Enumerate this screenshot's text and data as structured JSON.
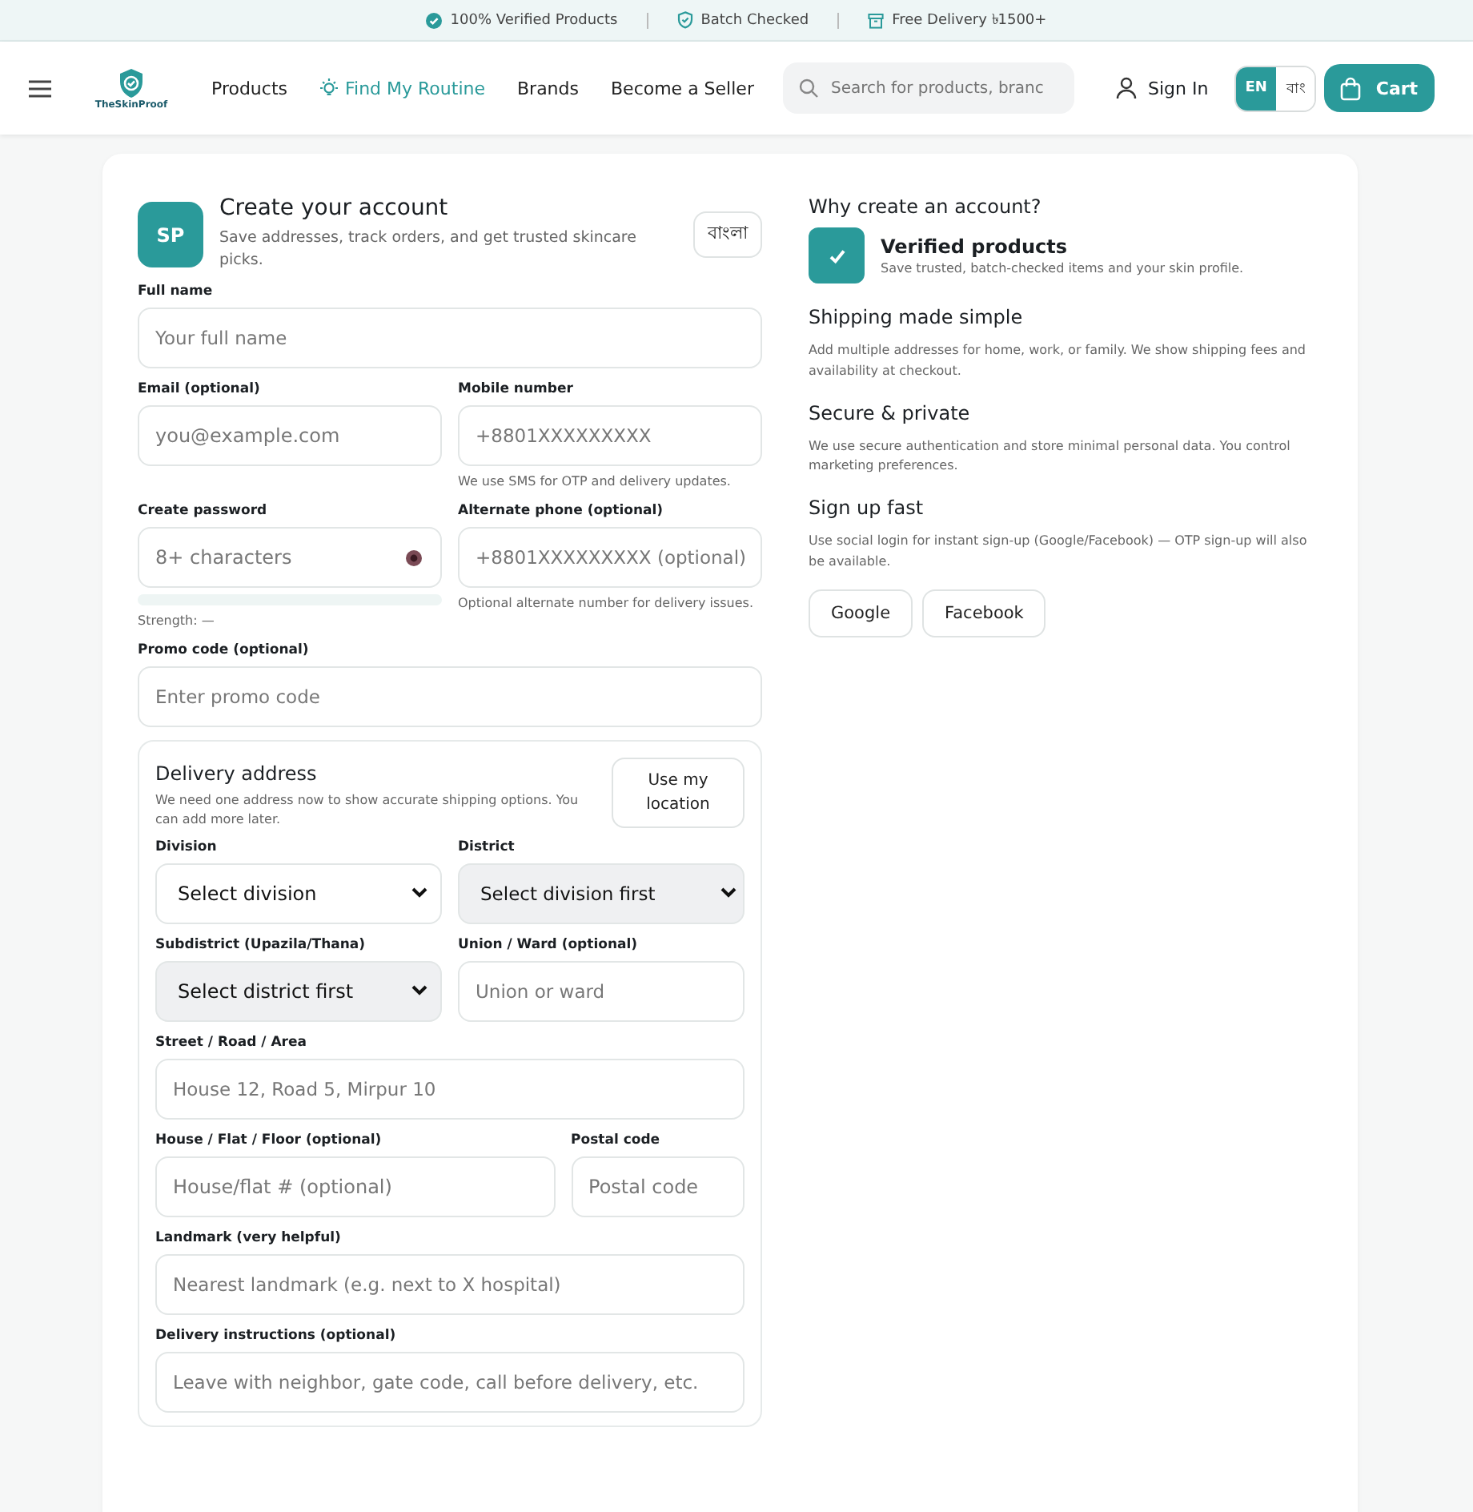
{
  "promo_bar": [
    {
      "text": "100% Verified Products"
    },
    {
      "text": "Batch Checked"
    },
    {
      "text": "Free Delivery ৳1500+"
    }
  ],
  "header": {
    "logo_text": "TheSkinProof",
    "nav": [
      {
        "label": "Products",
        "selected": false
      },
      {
        "label": "Find My Routine",
        "selected": true
      },
      {
        "label": "Brands",
        "selected": false
      },
      {
        "label": "Become a Seller",
        "selected": false
      }
    ],
    "search": {
      "placeholder": "Search for products, branc"
    },
    "sign_in": "Sign In",
    "languages": [
      {
        "label": "EN",
        "selected": true
      },
      {
        "label": "বাং",
        "selected": false
      }
    ],
    "cart": "Cart"
  },
  "signup": {
    "avatar": "SP",
    "title": "Create your account",
    "subtitle": "Save addresses, track orders, and get trusted skincare picks.",
    "lang_button": "বাংলা",
    "rows": [
      {
        "kind": "even",
        "fields": [
          {
            "kind": "input",
            "label": "Full name",
            "placeholder": "Your full name"
          }
        ]
      },
      {
        "kind": "even",
        "fields": [
          {
            "kind": "input",
            "label": "Email (optional)",
            "placeholder": "you@example.com"
          },
          {
            "kind": "input",
            "label": "Mobile number",
            "placeholder": "+8801XXXXXXXXX",
            "hint": "We use SMS for OTP and delivery updates."
          }
        ]
      },
      {
        "kind": "even",
        "fields": [
          {
            "kind": "password",
            "label": "Create password",
            "placeholder": "8+ characters",
            "strength": "Strength: —"
          },
          {
            "kind": "input",
            "label": "Alternate phone (optional)",
            "placeholder": "+8801XXXXXXXXX (optional)",
            "hint": "Optional alternate number for delivery issues."
          }
        ]
      },
      {
        "kind": "even",
        "fields": [
          {
            "kind": "input",
            "label": "Promo code (optional)",
            "placeholder": "Enter promo code"
          }
        ]
      }
    ],
    "address": {
      "title": "Delivery address",
      "note": "We need one address now to show accurate shipping options. You can add more later.",
      "location_button": "Use my location",
      "rows": [
        {
          "kind": "even",
          "fields": [
            {
              "kind": "select",
              "label": "Division",
              "value": "Select division",
              "disabled": false
            },
            {
              "kind": "select",
              "label": "District",
              "value": "Select division first",
              "disabled": true
            }
          ]
        },
        {
          "kind": "even",
          "fields": [
            {
              "kind": "select",
              "label": "Subdistrict (Upazila/Thana)",
              "value": "Select district first",
              "disabled": true
            },
            {
              "kind": "input",
              "label": "Union / Ward (optional)",
              "placeholder": "Union or ward"
            }
          ]
        },
        {
          "kind": "even",
          "fields": [
            {
              "kind": "input",
              "label": "Street / Road / Area",
              "placeholder": "House 12, Road 5, Mirpur 10"
            }
          ]
        },
        {
          "kind": "wide-narrow",
          "fields": [
            {
              "kind": "input",
              "label": "House / Flat / Floor (optional)",
              "placeholder": "House/flat # (optional)"
            },
            {
              "kind": "input",
              "label": "Postal code",
              "placeholder": "Postal code"
            }
          ]
        },
        {
          "kind": "even",
          "fields": [
            {
              "kind": "input",
              "label": "Landmark (very helpful)",
              "placeholder": "Nearest landmark (e.g. next to X hospital)"
            }
          ]
        },
        {
          "kind": "even",
          "fields": [
            {
              "kind": "input",
              "label": "Delivery instructions (optional)",
              "placeholder": "Leave with neighbor, gate code, call before delivery, etc."
            }
          ]
        }
      ]
    }
  },
  "benefits": {
    "title": "Why create an account?",
    "items": [
      {
        "kind": "featured",
        "title": "Verified products",
        "text": "Save trusted, batch-checked items and your skin profile."
      },
      {
        "kind": "plain",
        "title": "Shipping made simple",
        "text": "Add multiple addresses for home, work, or family. We show shipping fees and availability at checkout."
      },
      {
        "kind": "plain",
        "title": "Secure & private",
        "text": "We use secure authentication and store minimal personal data. You control marketing preferences."
      },
      {
        "kind": "plain",
        "title": "Sign up fast",
        "text": "Use social login for instant sign-up (Google/Facebook) — OTP sign-up will also be available."
      }
    ],
    "social_buttons": [
      "Google",
      "Facebook"
    ]
  }
}
